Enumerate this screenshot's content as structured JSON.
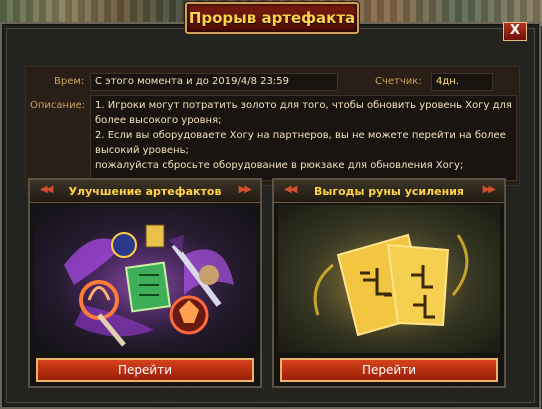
{
  "window": {
    "title": "Прорыв артефакта",
    "close_label": "X"
  },
  "info": {
    "time_label": "Врем:",
    "time_value": "С этого момента и до 2019/4/8 23:59",
    "counter_label": "Счетчик:",
    "counter_value": "4дн.",
    "desc_label": "Описание:",
    "desc_lines": [
      "1. Игроки могут потратить золото для того, чтобы обновить уровень Хогу для",
      "более высокого уровня;",
      "2. Если вы оборудоваете  Хогу на партнеров, вы не можете перейти на более",
      "высокий уровень;",
      "пожалуйста сбросьте оборудование в рюкзаке для обновления  Хогу;"
    ]
  },
  "cards": [
    {
      "title": "Улучшение артефактов",
      "button_label": "Перейти"
    },
    {
      "title": "Выгоды руны усиления",
      "button_label": "Перейти"
    }
  ],
  "colors": {
    "accent_gold": "#ffd24a",
    "button_red": "#c83a18",
    "label_gold": "#c8a25a"
  }
}
